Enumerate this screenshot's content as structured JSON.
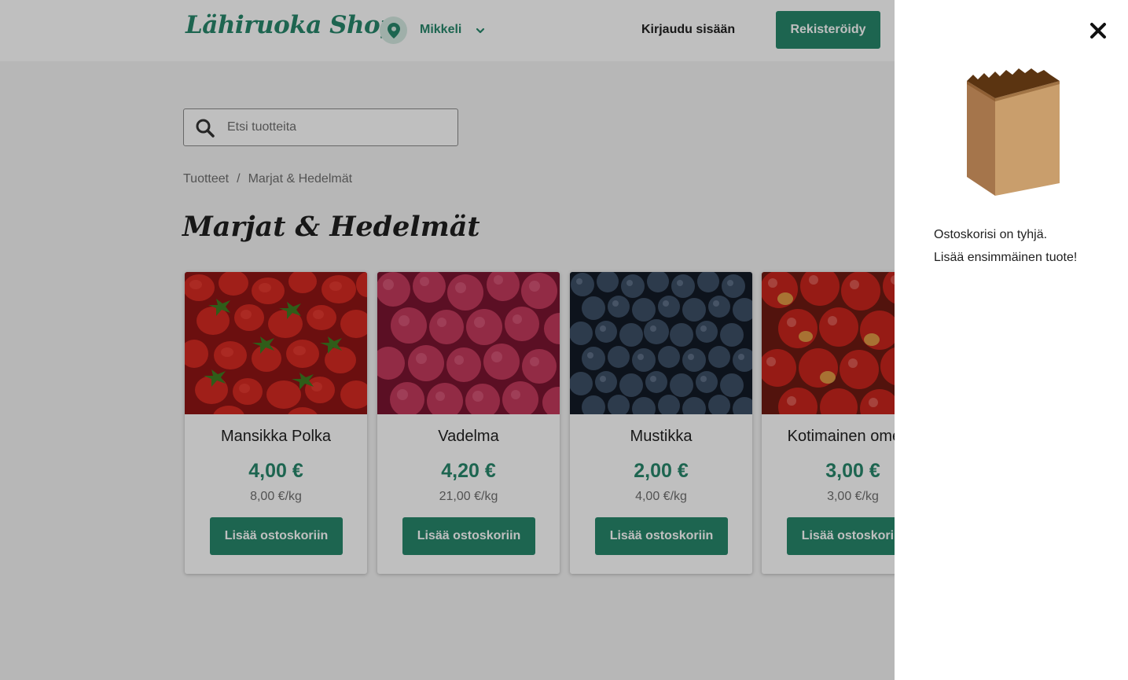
{
  "header": {
    "logo": "Lähiruoka Shop",
    "location": "Mikkeli",
    "login_label": "Kirjaudu sisään",
    "register_label": "Rekisteröidy"
  },
  "search": {
    "placeholder": "Etsi tuotteita"
  },
  "breadcrumb": {
    "items": [
      "Tuotteet",
      "Marjat & Hedelmät"
    ],
    "separator": "/"
  },
  "page_title": "Marjat & Hedelmät",
  "products": [
    {
      "name": "Mansikka Polka",
      "price": "4,00 €",
      "unit_price": "8,00 €/kg",
      "button": "Lisää ostoskoriin",
      "image": "strawberries"
    },
    {
      "name": "Vadelma",
      "price": "4,20 €",
      "unit_price": "21,00 €/kg",
      "button": "Lisää ostoskoriin",
      "image": "raspberries"
    },
    {
      "name": "Mustikka",
      "price": "2,00 €",
      "unit_price": "4,00 €/kg",
      "button": "Lisää ostoskoriin",
      "image": "blueberries"
    },
    {
      "name": "Kotimainen omena",
      "price": "3,00 €",
      "unit_price": "3,00 €/kg",
      "button": "Lisää ostoskoriin",
      "image": "apples"
    }
  ],
  "cart": {
    "empty_line1": "Ostoskorisi on tyhjä.",
    "empty_line2": "Lisää ensimmäinen tuote!",
    "icon": "paper-bag-icon",
    "close_icon": "close-icon"
  },
  "colors": {
    "brand": "#27876b",
    "brand_light": "#d4eae2",
    "text": "#1f1f1f",
    "muted": "#6f6f6f"
  }
}
